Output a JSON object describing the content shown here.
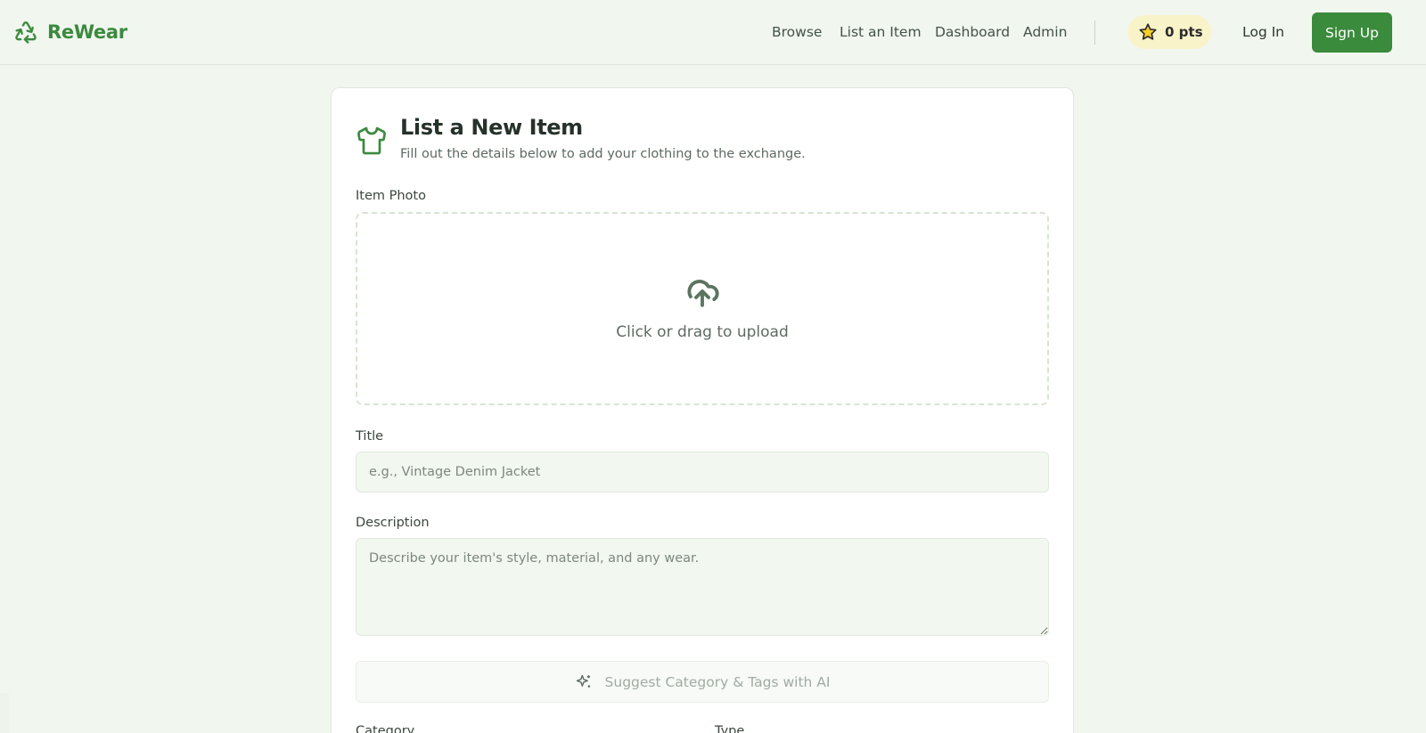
{
  "header": {
    "brand": "ReWear",
    "nav": [
      "Browse",
      "List an Item",
      "Dashboard",
      "Admin"
    ],
    "points": "0 pts",
    "login": "Log In",
    "signup": "Sign Up"
  },
  "form": {
    "title": "List a New Item",
    "subtitle": "Fill out the details below to add your clothing to the exchange.",
    "photo_label": "Item Photo",
    "upload_text": "Click or drag to upload",
    "title_label": "Title",
    "title_placeholder": "e.g., Vintage Denim Jacket",
    "description_label": "Description",
    "description_placeholder": "Describe your item's style, material, and any wear.",
    "ai_button": "Suggest Category & Tags with AI",
    "category_label": "Category",
    "type_label": "Type"
  },
  "colors": {
    "brand": "#3b8a3e",
    "background": "#f1f6ef",
    "points_badge": "#f9f3c9"
  },
  "icons": {
    "brand": "recycle-icon",
    "points": "star-icon",
    "card": "shirt-icon",
    "upload": "cloud-upload-icon",
    "ai": "sparkles-icon"
  }
}
